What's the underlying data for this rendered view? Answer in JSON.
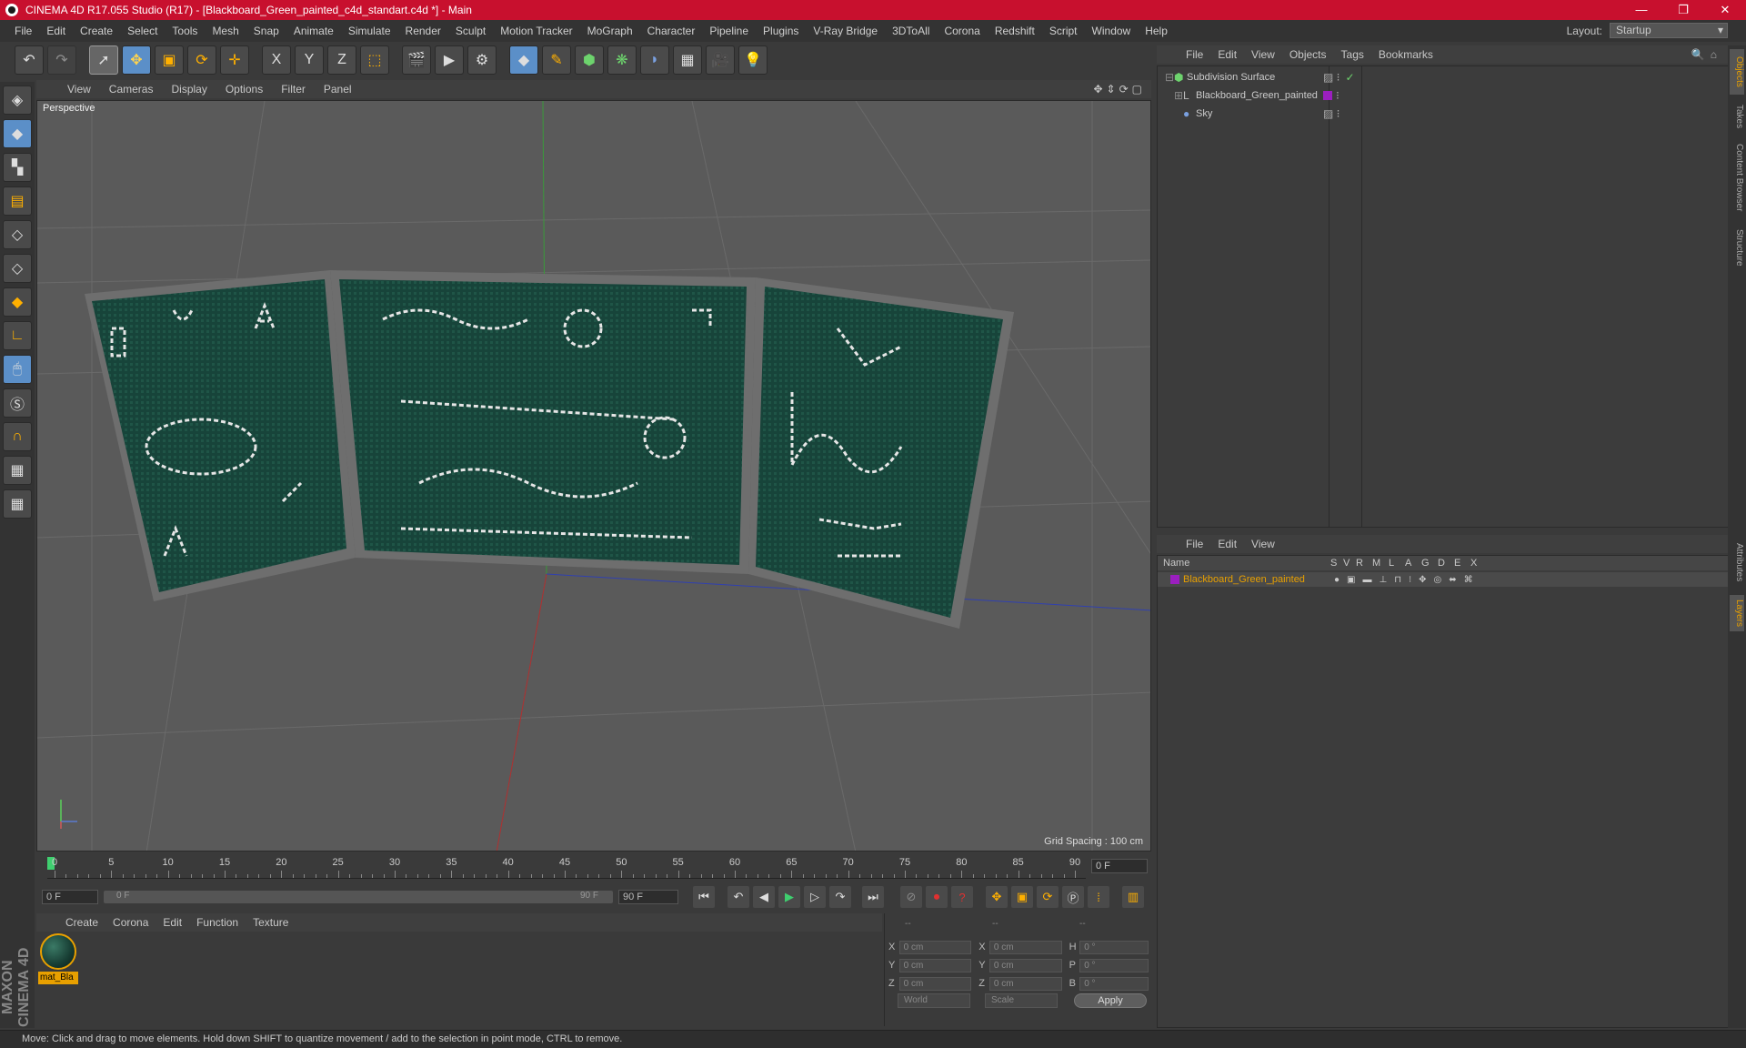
{
  "window": {
    "title": "CINEMA 4D R17.055 Studio (R17) - [Blackboard_Green_painted_c4d_standart.c4d *] - Main",
    "buttons": [
      "—",
      "❐",
      "✕"
    ]
  },
  "menubar": {
    "items": [
      "File",
      "Edit",
      "Create",
      "Select",
      "Tools",
      "Mesh",
      "Snap",
      "Animate",
      "Simulate",
      "Render",
      "Sculpt",
      "Motion Tracker",
      "MoGraph",
      "Character",
      "Pipeline",
      "Plugins",
      "V-Ray Bridge",
      "3DToAll",
      "Corona",
      "Redshift",
      "Script",
      "Window",
      "Help"
    ],
    "layout_label": "Layout:",
    "layout_value": "Startup"
  },
  "toolbar": {
    "icons": [
      "undo-icon",
      "redo-icon",
      "select-icon",
      "move-icon",
      "scale-icon",
      "rotate-icon",
      "transform-icon",
      "x-axis-icon",
      "y-axis-icon",
      "z-axis-icon",
      "coord-system-icon",
      "render-view-icon",
      "render-picture-icon",
      "render-settings-icon",
      "cube-icon",
      "pen-icon",
      "subdivision-icon",
      "cloner-icon",
      "deformer-icon",
      "floor-icon",
      "camera-icon",
      "light-icon"
    ],
    "axis_labels": [
      "X",
      "Y",
      "Z"
    ]
  },
  "viewport": {
    "menu": [
      "View",
      "Cameras",
      "Display",
      "Options",
      "Filter",
      "Panel"
    ],
    "label": "Perspective",
    "grid_spacing": "Grid Spacing : 100 cm",
    "board_color": "#17443a"
  },
  "timeline": {
    "ticks": [
      "0",
      "5",
      "10",
      "15",
      "20",
      "25",
      "30",
      "35",
      "40",
      "45",
      "50",
      "55",
      "60",
      "65",
      "70",
      "75",
      "80",
      "85",
      "90"
    ],
    "current_frame": "0 F",
    "start_field": "0 F",
    "range_start": "0 F",
    "range_end": "90 F",
    "end_field": "90 F"
  },
  "materials": {
    "menu": [
      "Create",
      "Corona",
      "Edit",
      "Function",
      "Texture"
    ],
    "items": [
      {
        "label": "mat_Bla"
      }
    ]
  },
  "coords": {
    "headers": [
      "--",
      "--",
      "--"
    ],
    "rows": [
      {
        "a": "X",
        "av": "0 cm",
        "b": "X",
        "bv": "0 cm",
        "c": "H",
        "cv": "0 °"
      },
      {
        "a": "Y",
        "av": "0 cm",
        "b": "Y",
        "bv": "0 cm",
        "c": "P",
        "cv": "0 °"
      },
      {
        "a": "Z",
        "av": "0 cm",
        "b": "Z",
        "bv": "0 cm",
        "c": "B",
        "cv": "0 °"
      }
    ],
    "world": "World",
    "scale": "Scale",
    "apply": "Apply"
  },
  "objects": {
    "menu": [
      "File",
      "Edit",
      "View",
      "Objects",
      "Tags",
      "Bookmarks"
    ],
    "rows": [
      {
        "name": "Subdivision Surface"
      },
      {
        "name": "Blackboard_Green_painted"
      },
      {
        "name": "Sky"
      }
    ]
  },
  "layers": {
    "menu": [
      "File",
      "Edit",
      "View"
    ],
    "header_name": "Name",
    "header_cols": [
      "S",
      "V",
      "R",
      "M",
      "L",
      "A",
      "G",
      "D",
      "E",
      "X"
    ],
    "row_name": "Blackboard_Green_painted",
    "row_color": "#e8a000"
  },
  "edge_tabs": [
    "Objects",
    "Takes",
    "Content Browser",
    "Structure",
    "Attributes",
    "Layers"
  ],
  "status": "Move: Click and drag to move elements. Hold down SHIFT to quantize movement / add to the selection in point mode, CTRL to remove.",
  "logo": "MAXON CINEMA 4D"
}
